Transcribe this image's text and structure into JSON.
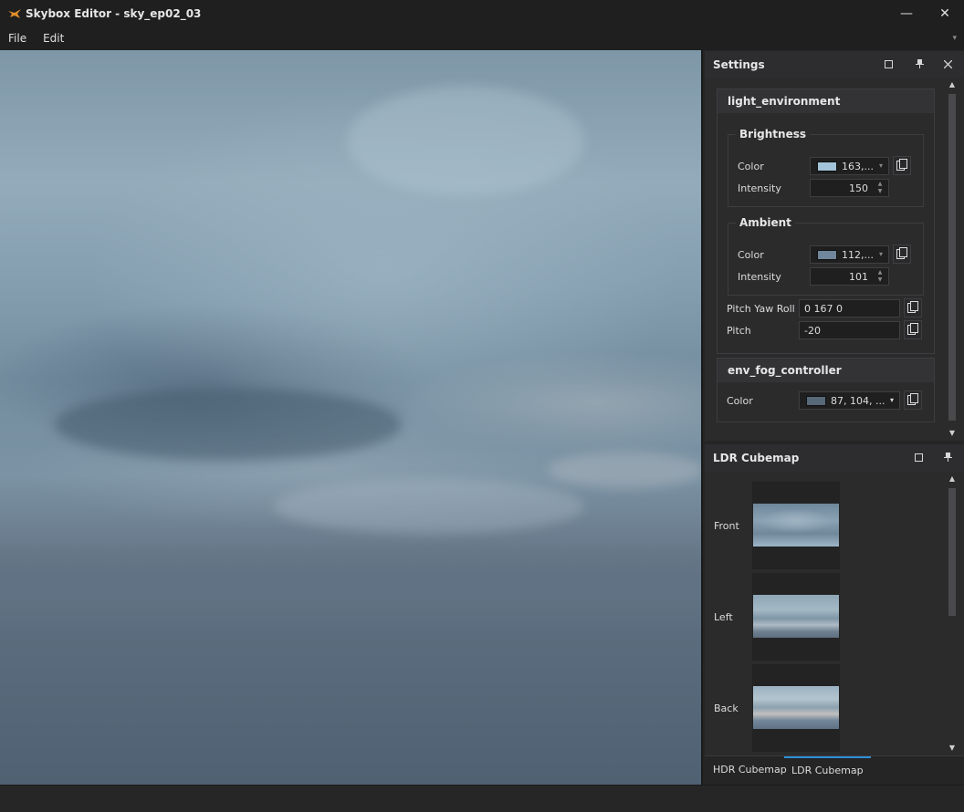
{
  "window": {
    "title": "Skybox Editor - sky_ep02_03",
    "minimize_glyph": "—",
    "close_glyph": "✕"
  },
  "menu": {
    "items": [
      "File",
      "Edit"
    ],
    "overflow_glyph": "▾"
  },
  "settings_panel": {
    "title": "Settings",
    "light_environment": {
      "title": "light_environment",
      "brightness": {
        "title": "Brightness",
        "color_label": "Color",
        "color_value": "163,...",
        "color_swatch": "#a3c3d9",
        "intensity_label": "Intensity",
        "intensity_value": "150"
      },
      "ambient": {
        "title": "Ambient",
        "color_label": "Color",
        "color_value": "112,...",
        "color_swatch": "#70869a",
        "intensity_label": "Intensity",
        "intensity_value": "101"
      },
      "pitch_yaw_roll_label": "Pitch Yaw Roll",
      "pitch_yaw_roll_value": "0 167 0",
      "pitch_label": "Pitch",
      "pitch_value": "-20"
    },
    "env_fog_controller": {
      "title": "env_fog_controller",
      "color_label": "Color",
      "color_value": "87, 104, ...",
      "color_swatch": "#576878"
    }
  },
  "cubemap_panel": {
    "title": "LDR Cubemap",
    "faces": [
      {
        "label": "Front"
      },
      {
        "label": "Left"
      },
      {
        "label": "Back"
      }
    ]
  },
  "tabs": [
    {
      "label": "HDR Cubemap",
      "active": false
    },
    {
      "label": "LDR Cubemap",
      "active": true
    }
  ],
  "colors": {
    "accent": "#2d8fd8",
    "app_icon": "#e0902a"
  },
  "icons": {
    "app": "fox-logo-icon",
    "float": "float-window-icon",
    "pin": "pin-icon",
    "close": "close-icon",
    "copy": "copy-icon"
  }
}
